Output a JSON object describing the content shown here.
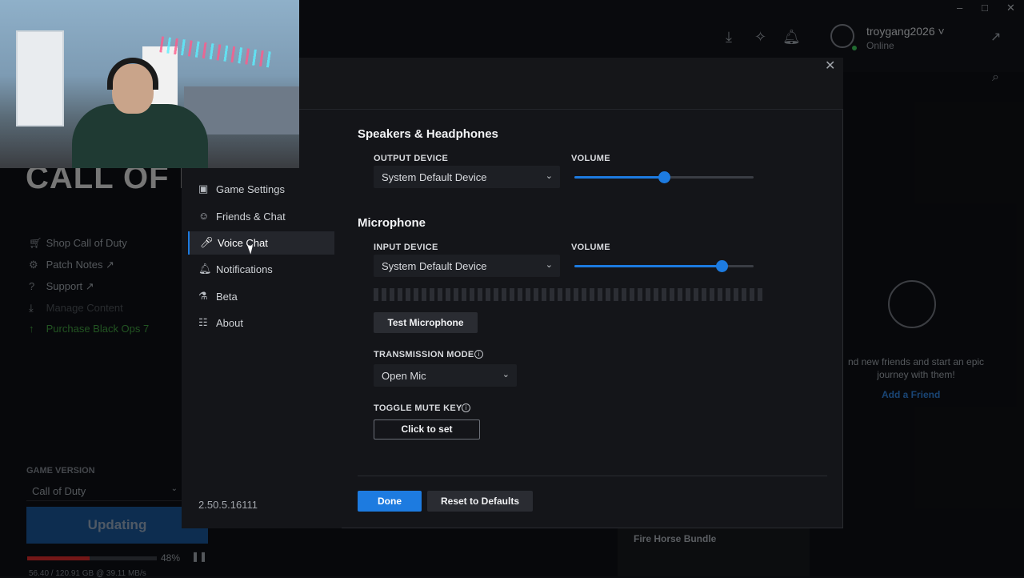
{
  "window": {
    "minimize": "–",
    "maximize": "□",
    "close": "✕"
  },
  "header": {
    "username": "troygang2026 ˅",
    "status": "Online"
  },
  "left_panel": {
    "logo": "CALL OF DUTY",
    "nav": [
      {
        "label": "Shop Call of Duty",
        "icon": "cart-icon"
      },
      {
        "label": "Patch Notes ↗",
        "icon": "gear-icon"
      },
      {
        "label": "Support ↗",
        "icon": "help-icon"
      },
      {
        "label": "Manage Content",
        "icon": "download-icon"
      },
      {
        "label": "Purchase Black Ops 7",
        "icon": "purchase-icon"
      }
    ],
    "game_version_label": "GAME VERSION",
    "game_version_value": "Call of Duty",
    "update_button": "Updating",
    "progress_percent": 48,
    "progress_label": "48%",
    "download_stats": "56.40 / 120.91 GB @ 39.11 MB/s"
  },
  "friends_panel": {
    "empty_text": "nd new friends and start an epic journey with them!",
    "add_friend": "Add a Friend"
  },
  "promo": {
    "title": "Fire Horse Bundle"
  },
  "settings": {
    "nav": [
      {
        "label": "Game Settings",
        "icon": "game-settings-icon",
        "active": false
      },
      {
        "label": "Friends & Chat",
        "icon": "friends-icon",
        "active": false
      },
      {
        "label": "Voice Chat",
        "icon": "microphone-icon",
        "active": true
      },
      {
        "label": "Notifications",
        "icon": "bell-icon",
        "active": false
      },
      {
        "label": "Beta",
        "icon": "flask-icon",
        "active": false
      },
      {
        "label": "About",
        "icon": "document-icon",
        "active": false
      }
    ],
    "version": "2.50.5.16111",
    "speakers": {
      "title": "Speakers & Headphones",
      "output_label": "OUTPUT DEVICE",
      "output_value": "System Default Device",
      "volume_label": "VOLUME",
      "volume": 0.5
    },
    "microphone": {
      "title": "Microphone",
      "input_label": "INPUT DEVICE",
      "input_value": "System Default Device",
      "volume_label": "VOLUME",
      "volume": 0.82,
      "test_button": "Test Microphone",
      "transmission_label": "TRANSMISSION MODE",
      "transmission_value": "Open Mic",
      "toggle_mute_label": "TOGGLE MUTE KEY",
      "toggle_mute_button": "Click to set"
    },
    "done_button": "Done",
    "reset_button": "Reset to Defaults"
  }
}
